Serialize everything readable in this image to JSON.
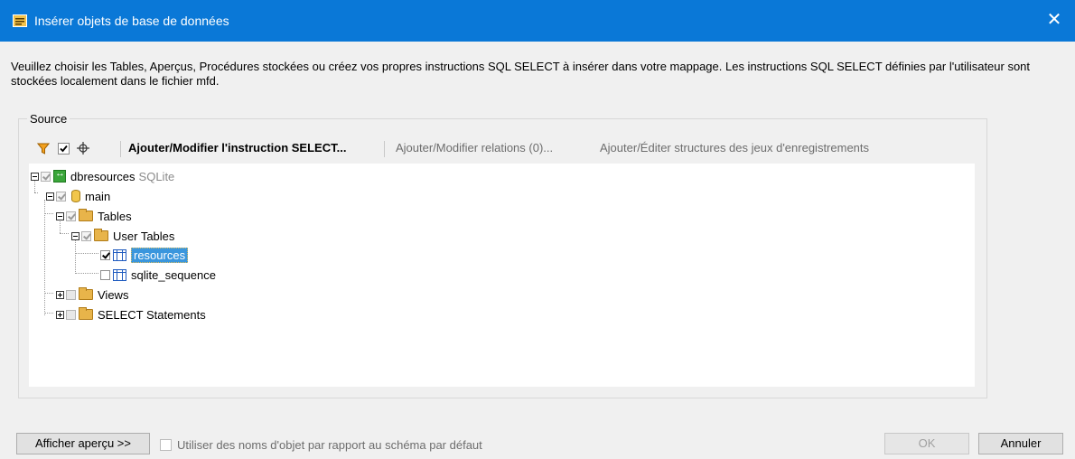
{
  "window": {
    "title": "Insérer objets de base de données",
    "close_glyph": "✕"
  },
  "description": "Veuillez choisir les Tables, Aperçus, Procédures stockées ou créez vos propres instructions SQL SELECT à insérer dans votre mappage. Les instructions SQL SELECT définies par l'utilisateur sont stockées localement dans le fichier mfd.",
  "source_group": {
    "label": "Source"
  },
  "toolbar": {
    "filter_icon": "filter-icon",
    "check_icon": "check-icon",
    "locate_icon": "locate-icon",
    "select_statement_label": "Ajouter/Modifier l'instruction SELECT...",
    "relations_label": "Ajouter/Modifier relations (0)...",
    "recordset_label": "Ajouter/Éditer structures des jeux d'enregistrements"
  },
  "tree": {
    "root": {
      "label": "dbresources",
      "type": "SQLite"
    },
    "schema": {
      "label": "main"
    },
    "tables": {
      "label": "Tables"
    },
    "user_tables": {
      "label": "User Tables"
    },
    "resources": {
      "label": "resources",
      "checked": true,
      "selected": true
    },
    "sqlite_sequence": {
      "label": "sqlite_sequence",
      "checked": false
    },
    "views": {
      "label": "Views"
    },
    "select_statements": {
      "label": "SELECT Statements"
    }
  },
  "footer": {
    "preview_button": "Afficher aperçu >>",
    "schema_names_checkbox": "Utiliser des noms d'objet par rapport au schéma par défaut",
    "ok_button": "OK",
    "cancel_button": "Annuler"
  },
  "colors": {
    "titlebar": "#0a78d7",
    "selection": "#3a96dd",
    "folder": "#e8b44a"
  }
}
